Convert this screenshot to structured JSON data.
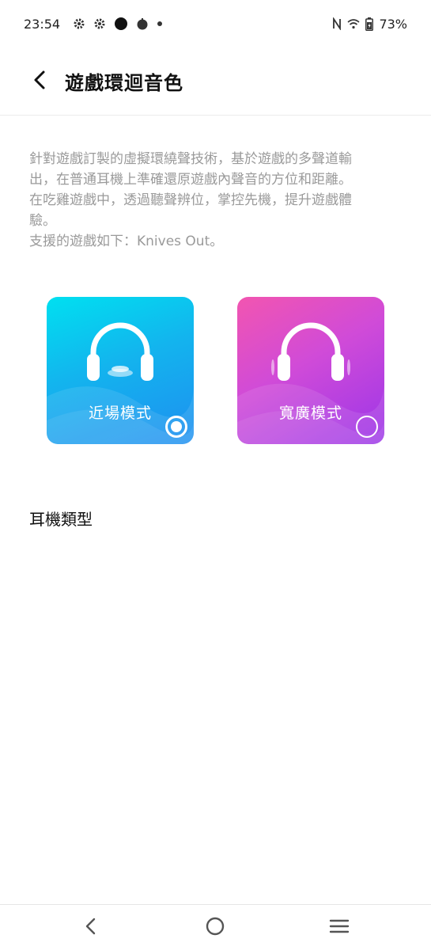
{
  "status_bar": {
    "time": "23:54",
    "battery": "73%",
    "icons": [
      "gear-icon",
      "gear-icon",
      "circle-notification-icon",
      "app-notification-icon",
      "dot-icon",
      "nfc-icon",
      "wifi-icon",
      "battery-icon"
    ]
  },
  "app_bar": {
    "title": "遊戲環迴音色"
  },
  "description": {
    "lines": [
      "針對遊戲訂製的虛擬環繞聲技術，基於遊戲的多聲道輸",
      "出，在普通耳機上準確還原遊戲內聲音的方位和距離。",
      "在吃雞遊戲中，透過聽聲辨位，掌控先機，提升遊戲體",
      "驗。",
      "支援的遊戲如下：Knives Out。"
    ]
  },
  "modes": [
    {
      "label": "近場模式",
      "selected": true,
      "color": "#13b4ee"
    },
    {
      "label": "寬廣模式",
      "selected": false,
      "color": "#d04bd8"
    }
  ],
  "section": {
    "headphone_type": "耳機類型"
  },
  "nav": {
    "icons": [
      "back-triangle-icon",
      "home-circle-icon",
      "menu-lines-icon"
    ]
  }
}
